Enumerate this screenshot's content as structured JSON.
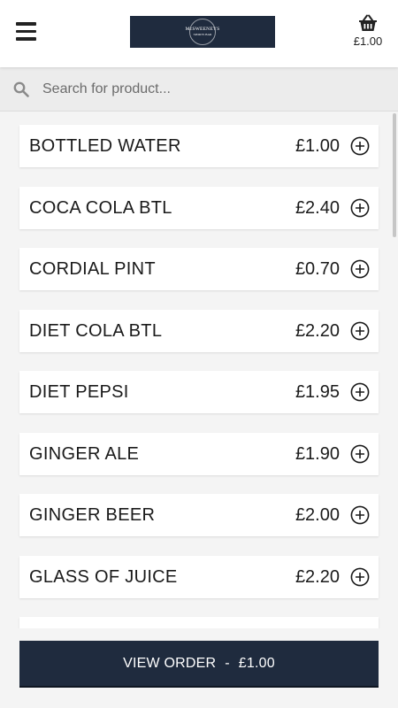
{
  "header": {
    "menu_icon": "hamburger-menu-icon",
    "logo": {
      "line1": "McSWEENEYS",
      "line2": "SPORTS BAR",
      "bg_color": "#1f2b3e"
    },
    "basket_icon": "basket-icon",
    "basket_total": "£1.00"
  },
  "search": {
    "icon": "search-icon",
    "placeholder": "Search for product...",
    "value": ""
  },
  "products": [
    {
      "name": "BOTTLED WATER",
      "price": "£1.00"
    },
    {
      "name": "COCA COLA BTL",
      "price": "£2.40"
    },
    {
      "name": "CORDIAL PINT",
      "price": "£0.70"
    },
    {
      "name": "DIET COLA BTL",
      "price": "£2.20"
    },
    {
      "name": "DIET PEPSI",
      "price": "£1.95"
    },
    {
      "name": "GINGER ALE",
      "price": "£1.90"
    },
    {
      "name": "GINGER BEER",
      "price": "£2.00"
    },
    {
      "name": "GLASS OF JUICE",
      "price": "£2.20"
    }
  ],
  "add_icon": "plus-circle-icon",
  "footer": {
    "button_label": "VIEW ORDER",
    "separator": "-",
    "order_total": "£1.00",
    "button_color": "#1f2b3e"
  }
}
